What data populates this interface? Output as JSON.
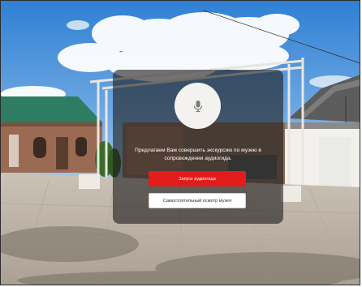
{
  "tour_dialog": {
    "prompt": "Предлагаем Вам совершить экскурсию по музею в сопровождении аудиогида.",
    "start_audio_guide_label": "Запуск аудиогида",
    "self_tour_label": "Самостоятельный осмотр музея",
    "mic_icon": "microphone-icon"
  },
  "colors": {
    "accent": "#e41b1b",
    "overlay": "#201e1e",
    "mic_circle": "#f3f2f0"
  }
}
